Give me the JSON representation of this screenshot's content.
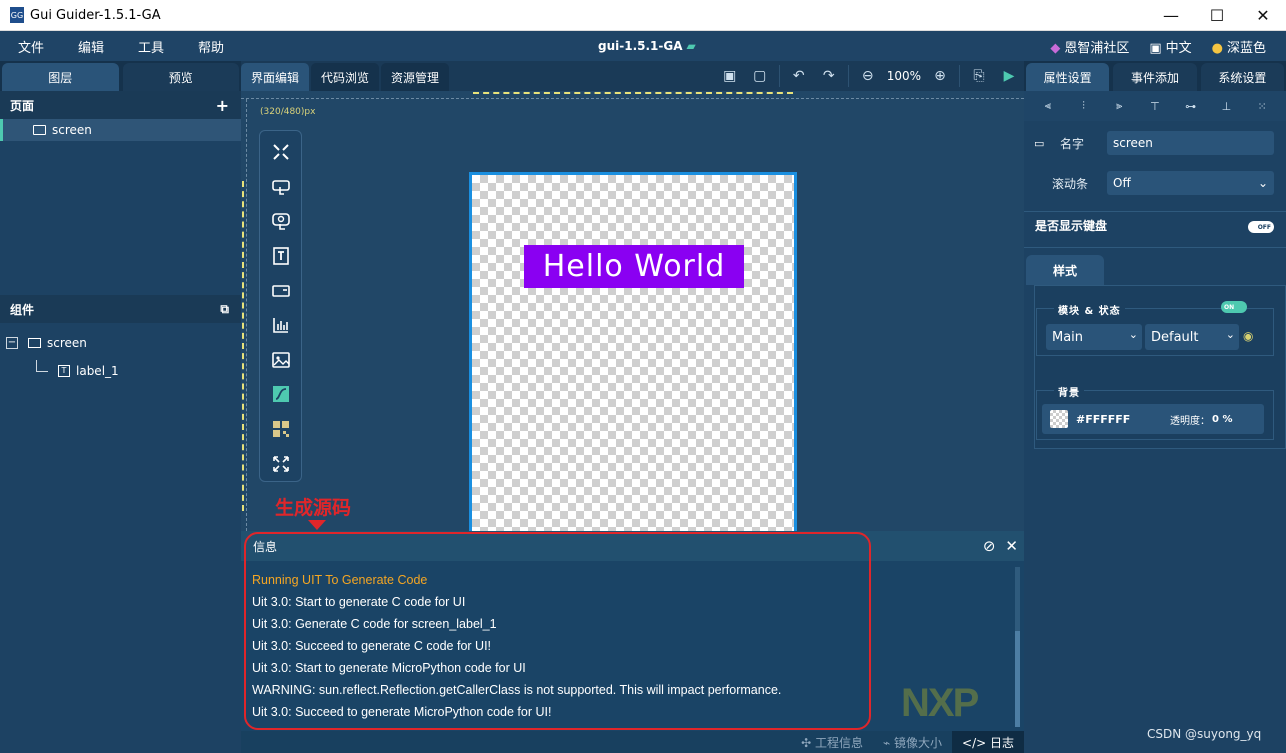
{
  "window": {
    "title": "Gui Guider-1.5.1-GA",
    "app_icon": "GG",
    "minimize": "—",
    "maximize": "☐",
    "close": "✕"
  },
  "menu": {
    "items": [
      "文件",
      "编辑",
      "工具",
      "帮助"
    ],
    "project": "gui-1.5.1-GA",
    "community": "恩智浦社区",
    "language": "中文",
    "theme": "深蓝色"
  },
  "left": {
    "tabs": [
      "图层",
      "预览"
    ],
    "pages_header": "页面",
    "add_icon": "+",
    "pages": [
      "screen"
    ],
    "components_header": "组件",
    "tree_root": "screen",
    "tree_child": "label_1",
    "collapse": "−",
    "label_icon_text": "T"
  },
  "center": {
    "tabs": [
      "界面编辑",
      "代码浏览",
      "资源管理"
    ],
    "zoom": "100%",
    "size_label": "(320/480)px",
    "hello_text": "Hello World",
    "annotation": "生成源码"
  },
  "info": {
    "title": "信息",
    "logs": [
      "Running UIT To Generate Code",
      "Uit 3.0: Start to generate C code for UI",
      "Uit 3.0: Generate C code for screen_label_1",
      "Uit 3.0: Succeed to generate C code for UI!",
      "Uit 3.0: Start to generate MicroPython code for UI",
      "WARNING: sun.reflect.Reflection.getCallerClass is not supported. This will impact performance.",
      "Uit 3.0: Succeed to generate MicroPython code for UI!"
    ],
    "logo": "NXP",
    "status_items": [
      "✣ 工程信息",
      "⌁ 镜像大小",
      "</> 日志"
    ]
  },
  "right": {
    "tabs": [
      "属性设置",
      "事件添加",
      "系统设置"
    ],
    "name_label": "名字",
    "name_value": "screen",
    "scroll_label": "滚动条",
    "scroll_value": "Off",
    "keyboard_label": "是否显示键盘",
    "keyboard_toggle": "OFF",
    "style_tab": "样式",
    "part_state_label": "模块 & 状态",
    "part_toggle": "ON",
    "part_value": "Main",
    "state_value": "Default",
    "bg_label": "背景",
    "bg_color": "#FFFFFF",
    "opacity_label": "透明度：",
    "opacity_value": "0 %"
  },
  "colors": {
    "accent": "#4ec9b0",
    "label_bg": "#8a00f2",
    "annotation": "#e0262a",
    "log_highlight": "#f5a623"
  },
  "watermark": "CSDN @suyong_yq"
}
